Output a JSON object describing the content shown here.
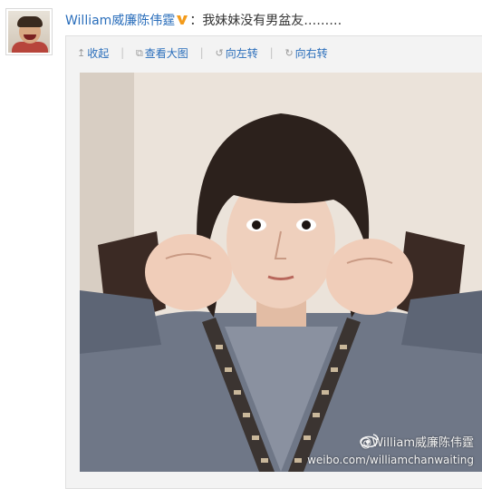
{
  "post": {
    "author": "William威廉陈伟霆",
    "colon": "：",
    "text": "我妹妹没有男盆友………",
    "verified_color": "#f39b1b"
  },
  "toolbar": {
    "collapse": "收起",
    "view_large": "查看大图",
    "rotate_left": "向左转",
    "rotate_right": "向右转",
    "separator": "|"
  },
  "icons": {
    "collapse": "up-arrow-icon",
    "view_large": "external-view-icon",
    "rotate_left": "rotate-left-icon",
    "rotate_right": "rotate-right-icon"
  },
  "photo": {
    "watermark_handle": "@William威廉陈伟霆",
    "watermark_url": "weibo.com/williamchanwaiting"
  },
  "colors": {
    "link": "#2a6ebb",
    "card_bg": "#f3f3f3"
  }
}
